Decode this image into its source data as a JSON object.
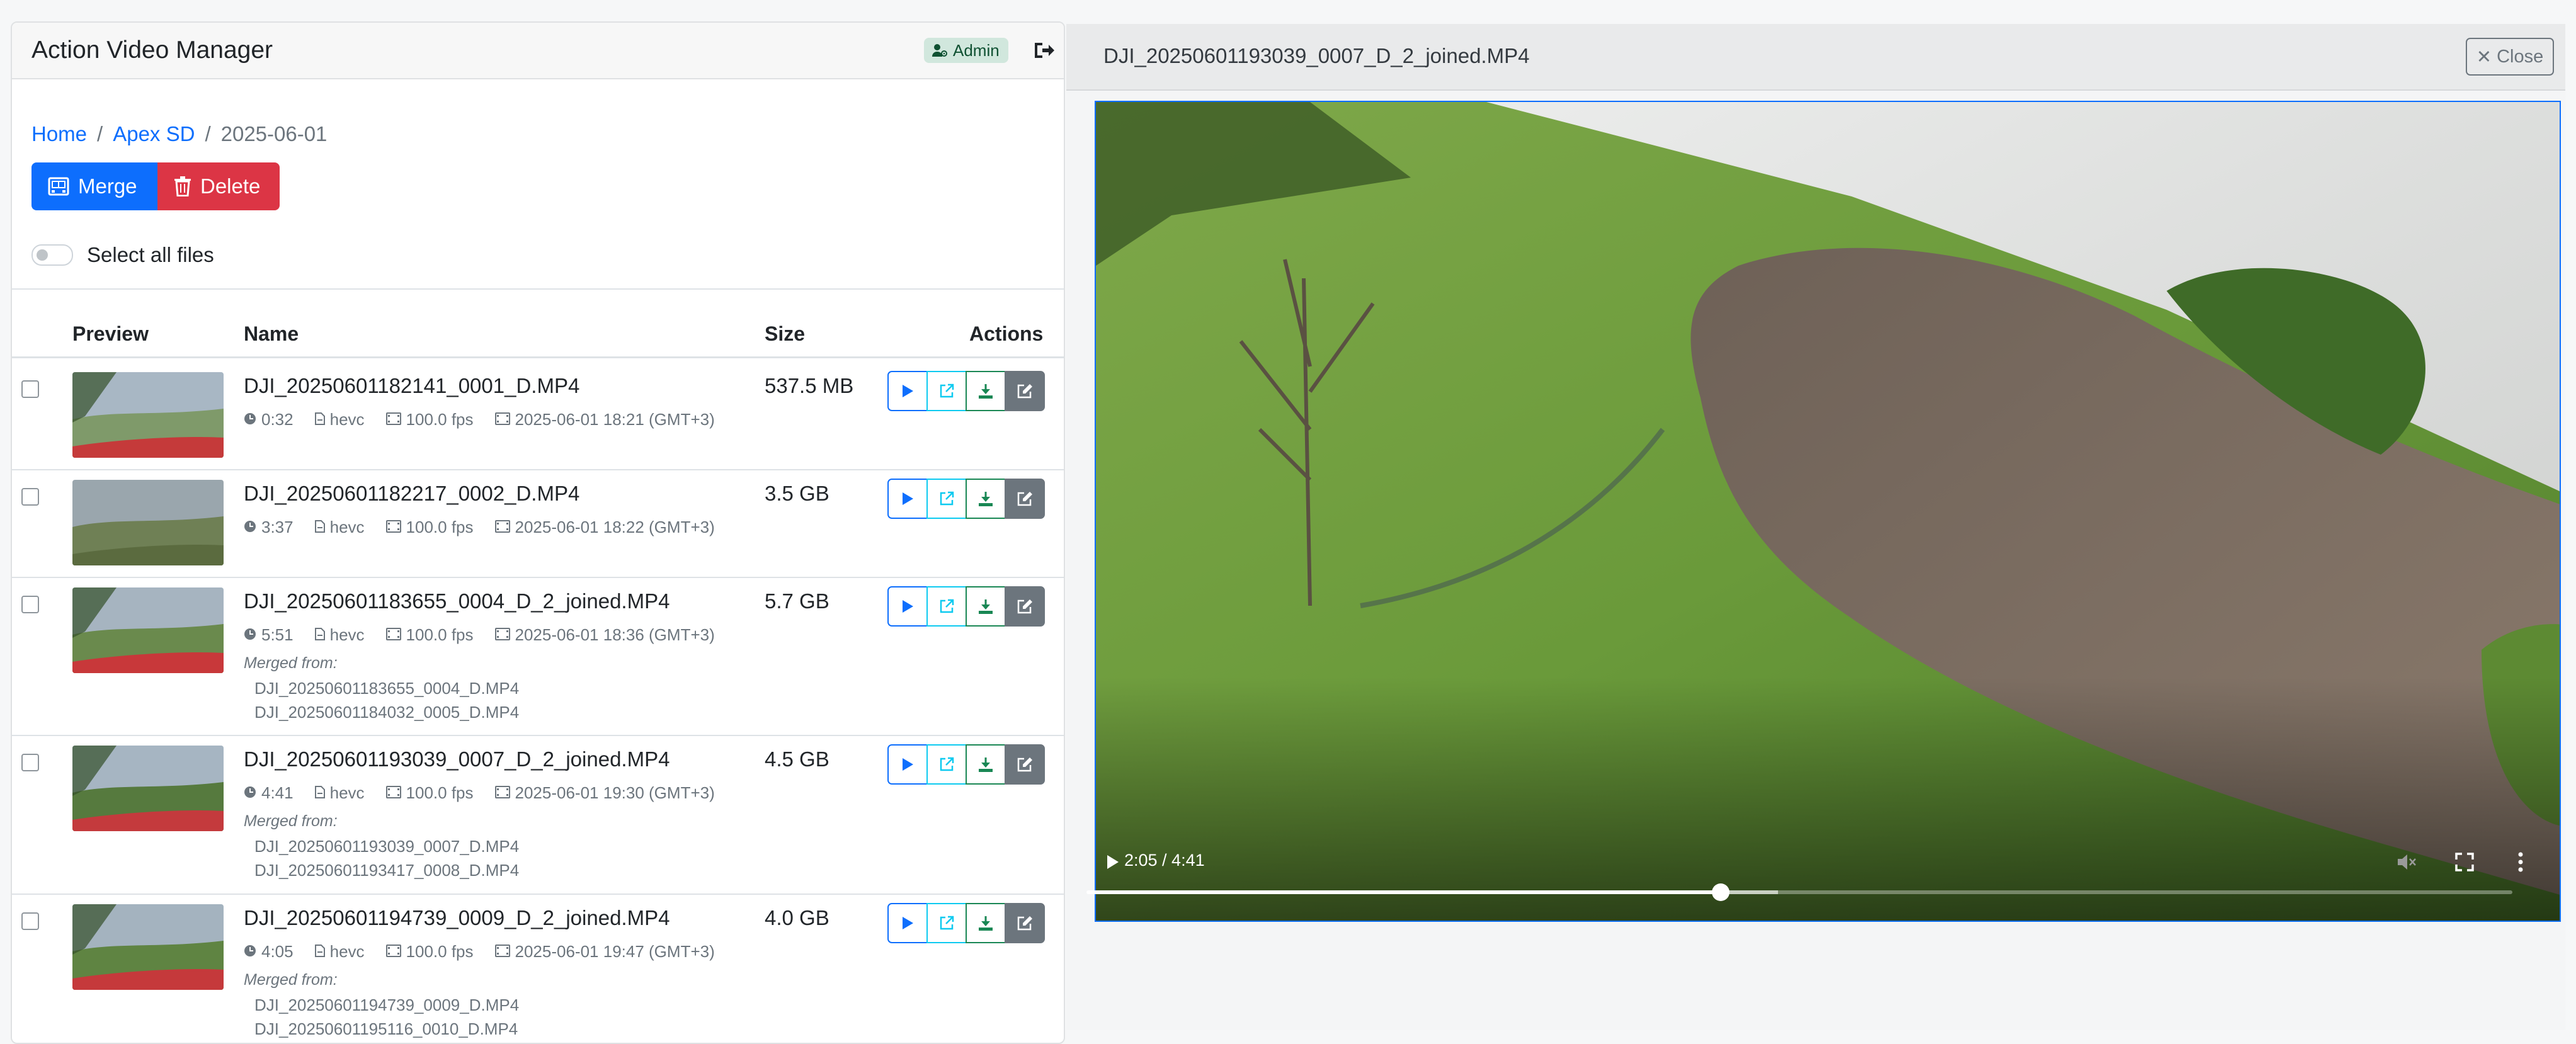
{
  "app": {
    "title": "Action Video Manager",
    "role_badge": "Admin",
    "icons": [
      "user-gear-icon",
      "logout-icon"
    ]
  },
  "breadcrumb": {
    "home": "Home",
    "separator": "/",
    "folder": "Apex SD",
    "current": "2025-06-01"
  },
  "toolbar": {
    "merge_label": "Merge",
    "delete_label": "Delete",
    "select_all_label": "Select all files"
  },
  "table": {
    "headers": {
      "preview": "Preview",
      "name": "Name",
      "size": "Size",
      "actions": "Actions"
    },
    "merged_from_label": "Merged from:",
    "rows": [
      {
        "name": "DJI_20250601182141_0001_D.MP4",
        "duration": "0:32",
        "codec": "hevc",
        "fps": "100.0 fps",
        "recorded": "2025-06-01 18:21 (GMT+3)",
        "size": "537.5 MB",
        "merged_from": []
      },
      {
        "name": "DJI_20250601182217_0002_D.MP4",
        "duration": "3:37",
        "codec": "hevc",
        "fps": "100.0 fps",
        "recorded": "2025-06-01 18:22 (GMT+3)",
        "size": "3.5 GB",
        "merged_from": []
      },
      {
        "name": "DJI_20250601183655_0004_D_2_joined.MP4",
        "duration": "5:51",
        "codec": "hevc",
        "fps": "100.0 fps",
        "recorded": "2025-06-01 18:36 (GMT+3)",
        "size": "5.7 GB",
        "merged_from": [
          "DJI_20250601183655_0004_D.MP4",
          "DJI_20250601184032_0005_D.MP4"
        ]
      },
      {
        "name": "DJI_20250601193039_0007_D_2_joined.MP4",
        "duration": "4:41",
        "codec": "hevc",
        "fps": "100.0 fps",
        "recorded": "2025-06-01 19:30 (GMT+3)",
        "size": "4.5 GB",
        "merged_from": [
          "DJI_20250601193039_0007_D.MP4",
          "DJI_20250601193417_0008_D.MP4"
        ]
      },
      {
        "name": "DJI_20250601194739_0009_D_2_joined.MP4",
        "duration": "4:05",
        "codec": "hevc",
        "fps": "100.0 fps",
        "recorded": "2025-06-01 19:47 (GMT+3)",
        "size": "4.0 GB",
        "merged_from": [
          "DJI_20250601194739_0009_D.MP4",
          "DJI_20250601195116_0010_D.MP4"
        ]
      }
    ],
    "row_actions": [
      "play-icon",
      "open-external-icon",
      "download-icon",
      "edit-icon"
    ]
  },
  "player": {
    "title": "DJI_20250601193039_0007_D_2_joined.MP4",
    "close_label": "Close",
    "close_glyph": "✕",
    "time_display": "2:05 / 4:41",
    "progress": 0.445,
    "buffered": 0.485
  },
  "colors": {
    "primary": "#0d6efd",
    "danger": "#dc3545",
    "success": "#198754",
    "info": "#0dcaf0",
    "secondary": "#6c757d",
    "badge_bg": "#d1e7dd",
    "badge_text": "#0f5132"
  }
}
